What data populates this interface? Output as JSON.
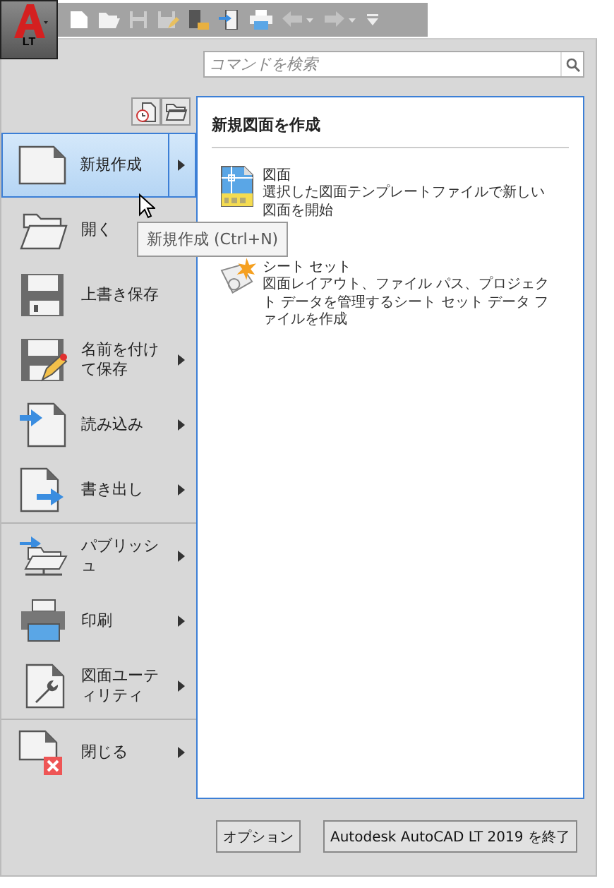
{
  "app_button": {
    "label": "LT"
  },
  "search": {
    "placeholder": "コマンドを検索"
  },
  "menu_groups": [
    [
      {
        "label": "新規作成",
        "has_submenu": true,
        "selected": true
      },
      {
        "label": "開く",
        "has_submenu": false,
        "selected": false
      },
      {
        "label": "上書き保存",
        "has_submenu": false,
        "selected": false
      },
      {
        "label": "名前を付けて保存",
        "has_submenu": true,
        "selected": false
      },
      {
        "label": "読み込み",
        "has_submenu": true,
        "selected": false
      },
      {
        "label": "書き出し",
        "has_submenu": true,
        "selected": false
      }
    ],
    [
      {
        "label": "パブリッシュ",
        "has_submenu": true,
        "selected": false
      },
      {
        "label": "印刷",
        "has_submenu": true,
        "selected": false
      },
      {
        "label": "図面ユーティリティ",
        "has_submenu": true,
        "selected": false
      }
    ],
    [
      {
        "label": "閉じる",
        "has_submenu": true,
        "selected": false
      }
    ]
  ],
  "tooltip": "新規作成 (Ctrl+N)",
  "panel": {
    "title": "新規図面を作成",
    "entries": [
      {
        "title": "図面",
        "description": "選択した図面テンプレートファイルで新しい図面を開始"
      },
      {
        "title": "シート セット",
        "description": "図面レイアウト、ファイル パス、プロジェクト データを管理するシート セット データ ファイルを作成"
      }
    ]
  },
  "buttons": [
    "オプション",
    "Autodesk AutoCAD LT 2019 を終了"
  ]
}
